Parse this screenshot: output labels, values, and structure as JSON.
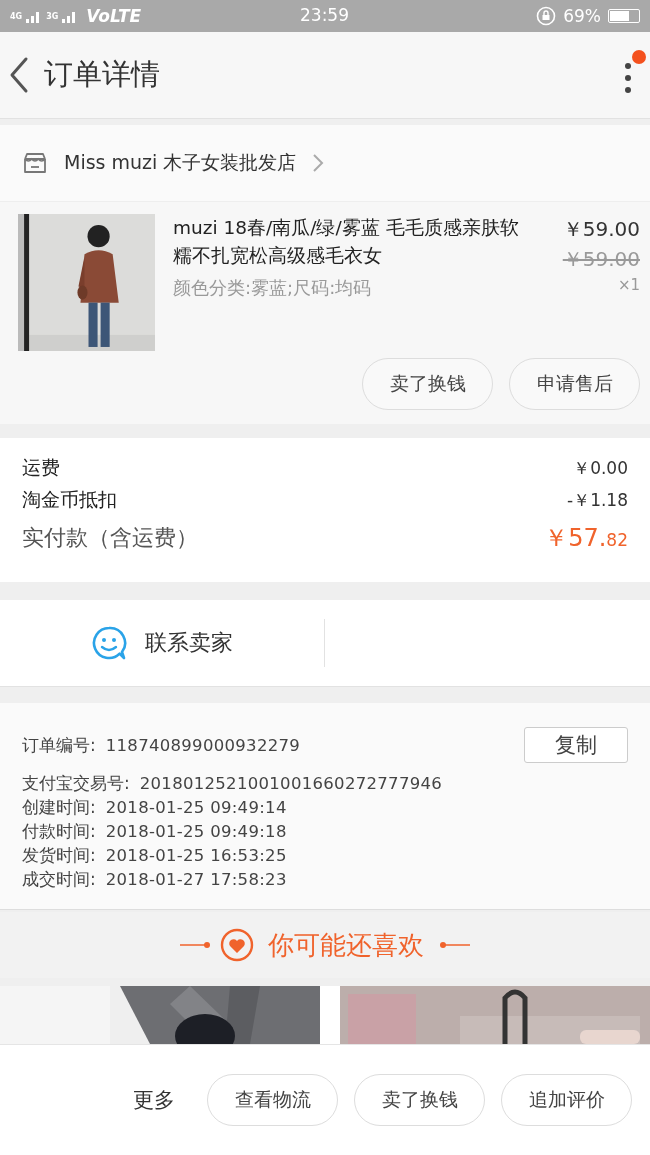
{
  "status_bar": {
    "network_1": "4G",
    "network_2": "3G",
    "volte": "VoLTE",
    "time": "23:59",
    "battery": "69%"
  },
  "header": {
    "title": "订单详情",
    "has_notification": true
  },
  "shop": {
    "name": "Miss muzi 木子女装批发店"
  },
  "product": {
    "title": "muzi 18春/南瓜/绿/雾蓝 毛毛质感亲肤软糯不扎宽松高级感毛衣女",
    "spec": "颜色分类:雾蓝;尺码:均码",
    "price": "￥59.00",
    "original_price": "￥59.00",
    "quantity": "×1",
    "actions": [
      "卖了换钱",
      "申请售后"
    ]
  },
  "fees": [
    {
      "label": "运费",
      "value": "￥0.00"
    },
    {
      "label": "淘金币抵扣",
      "value": "-￥1.18"
    }
  ],
  "total": {
    "label": "实付款（含运费）",
    "amount": "￥57.",
    "cents": "82"
  },
  "contact": {
    "label": "联系卖家"
  },
  "order_info": {
    "copy_button": "复制",
    "rows": [
      {
        "label": "订单编号:",
        "value": "118740899000932279"
      },
      {
        "label": "支付宝交易号:",
        "value": "2018012521001001660272777946"
      },
      {
        "label": "创建时间:",
        "value": "2018-01-25 09:49:14"
      },
      {
        "label": "付款时间:",
        "value": "2018-01-25 09:49:18"
      },
      {
        "label": "发货时间:",
        "value": "2018-01-25 16:53:25"
      },
      {
        "label": "成交时间:",
        "value": "2018-01-27 17:58:23"
      }
    ]
  },
  "recommend": {
    "title": "你可能还喜欢"
  },
  "bottom_bar": {
    "more": "更多",
    "buttons": [
      "查看物流",
      "卖了换钱",
      "追加评价"
    ]
  }
}
